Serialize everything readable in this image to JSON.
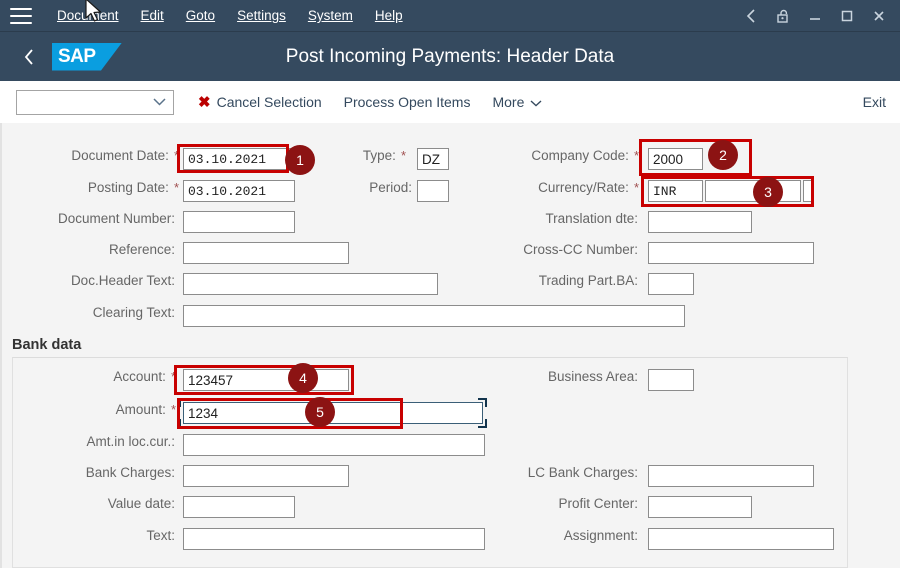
{
  "menubar": {
    "hamburger_label": "menu",
    "items": [
      {
        "label": "Document",
        "accel": "D"
      },
      {
        "label": "Edit",
        "accel": "E"
      },
      {
        "label": "Goto",
        "accel": "G"
      },
      {
        "label": "Settings",
        "accel": "S"
      },
      {
        "label": "System",
        "accel": "y"
      },
      {
        "label": "Help",
        "accel": "H"
      }
    ],
    "window_controls": [
      "back-icon",
      "lock-icon",
      "minimize-icon",
      "maximize-icon",
      "close-icon"
    ]
  },
  "titlebar": {
    "back_label": "Back",
    "logo_text": "SAP",
    "title": "Post Incoming Payments: Header Data"
  },
  "toolbar": {
    "select_value": "",
    "select_placeholder": "",
    "cancel_selection": "Cancel Selection",
    "process_open_items": "Process Open Items",
    "more": "More",
    "exit": "Exit"
  },
  "form": {
    "document_date": {
      "label": "Document Date:",
      "required": true,
      "value": "03.10.2021"
    },
    "posting_date": {
      "label": "Posting Date:",
      "required": true,
      "value": "03.10.2021"
    },
    "document_number": {
      "label": "Document Number:",
      "required": false,
      "value": ""
    },
    "reference": {
      "label": "Reference:",
      "required": false,
      "value": ""
    },
    "doc_header_text": {
      "label": "Doc.Header Text:",
      "required": false,
      "value": ""
    },
    "clearing_text": {
      "label": "Clearing Text:",
      "required": false,
      "value": ""
    },
    "type": {
      "label": "Type:",
      "required": true,
      "value": "DZ"
    },
    "period": {
      "label": "Period:",
      "required": false,
      "value": ""
    },
    "company_code": {
      "label": "Company Code:",
      "required": true,
      "value": "2000"
    },
    "currency_rate": {
      "label": "Currency/Rate:",
      "required": true,
      "value": "INR",
      "rate_value": "",
      "extra_value": ""
    },
    "translation_dte": {
      "label": "Translation dte:",
      "required": false,
      "value": ""
    },
    "cross_cc_number": {
      "label": "Cross-CC Number:",
      "required": false,
      "value": ""
    },
    "trading_part_ba": {
      "label": "Trading Part.BA:",
      "required": false,
      "value": ""
    }
  },
  "bank_data": {
    "section_label": "Bank data",
    "account": {
      "label": "Account:",
      "required": true,
      "value": "123457"
    },
    "amount": {
      "label": "Amount:",
      "required": true,
      "value": "1234",
      "focused": true
    },
    "amt_in_loc_cur": {
      "label": "Amt.in loc.cur.:",
      "required": false,
      "value": ""
    },
    "bank_charges": {
      "label": "Bank Charges:",
      "required": false,
      "value": ""
    },
    "value_date": {
      "label": "Value date:",
      "required": false,
      "value": ""
    },
    "text": {
      "label": "Text:",
      "required": false,
      "value": ""
    },
    "business_area": {
      "label": "Business Area:",
      "required": false,
      "value": ""
    },
    "lc_bank_charges": {
      "label": "LC Bank Charges:",
      "required": false,
      "value": ""
    },
    "profit_center": {
      "label": "Profit Center:",
      "required": false,
      "value": ""
    },
    "assignment": {
      "label": "Assignment:",
      "required": false,
      "value": ""
    }
  },
  "annotations": {
    "badges": [
      "1",
      "2",
      "3",
      "4",
      "5"
    ],
    "highlight_color": "#c80000",
    "badge_color": "#8c1313"
  },
  "colors": {
    "header_bg": "#354a5f",
    "sap_blue": "#0a9ee0",
    "link_text": "#34495e",
    "content_bg": "#f4f4f4",
    "cancel_icon": "#bb0000"
  }
}
